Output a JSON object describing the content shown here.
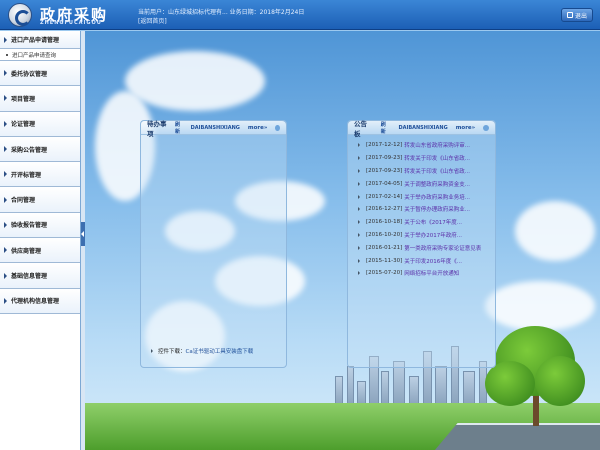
{
  "header": {
    "logo_title": "政府采购",
    "logo_sub": "ZHENGFUCAIGOU",
    "user_line1": "当前用户：山东绿城招标代理有... 业务日期：2018年2月24日",
    "user_line2": "[返回首页]",
    "logout_label": "退出",
    "logout_icon": "logout-icon"
  },
  "sidebar": {
    "items": [
      {
        "label": "进口产品申请管理",
        "sub": [
          "进口产品申请查询"
        ]
      },
      {
        "label": "委托协议管理"
      },
      {
        "label": "项目管理"
      },
      {
        "label": "论证管理"
      },
      {
        "label": "采购公告管理"
      },
      {
        "label": "开评标管理"
      },
      {
        "label": "合同管理"
      },
      {
        "label": "验收报告管理"
      },
      {
        "label": "供应商管理"
      },
      {
        "label": "基础信息管理"
      },
      {
        "label": "代理机构信息管理"
      }
    ]
  },
  "todo_panel": {
    "title": "待办事项",
    "refresh": "刷新",
    "pinyin": "DAIBANSHIXIANG",
    "more": "more»",
    "plugin_prefix": "控件下载：",
    "plugin_link": "Ca证书驱动工具安装盘下载"
  },
  "notice_panel": {
    "title": "公告板",
    "refresh": "刷新",
    "pinyin": "DAIBANSHIXIANG",
    "more": "more»",
    "items": [
      {
        "date": "[2017-12-12]",
        "title": "转发山东省政府采购评审..."
      },
      {
        "date": "[2017-09-23]",
        "title": "转发关于印发《山东省政..."
      },
      {
        "date": "[2017-09-23]",
        "title": "转发关于印发《山东省政..."
      },
      {
        "date": "[2017-04-05]",
        "title": "关于调整政府采购资金支..."
      },
      {
        "date": "[2017-02-14]",
        "title": "关于举办政府采购业务培..."
      },
      {
        "date": "[2016-12-27]",
        "title": "关于暂停办理政府采购业..."
      },
      {
        "date": "[2016-10-18]",
        "title": "关于公布《2017年度..."
      },
      {
        "date": "[2016-10-20]",
        "title": "关于举办2017年政府..."
      },
      {
        "date": "[2016-01-21]",
        "title": "第一类政府采购专家论证意见表"
      },
      {
        "date": "[2015-11-30]",
        "title": "关于印发2016年度《..."
      },
      {
        "date": "[2015-07-20]",
        "title": "网络招标平台开放通知"
      }
    ]
  }
}
